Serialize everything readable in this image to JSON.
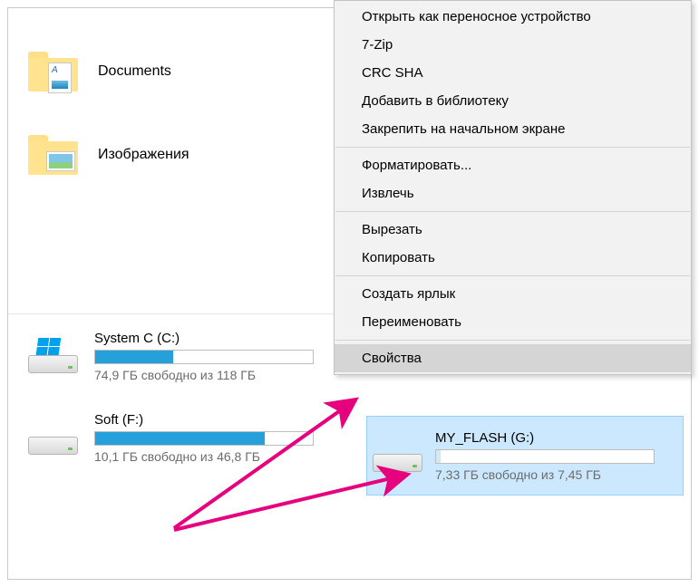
{
  "folders": {
    "docs": {
      "label": "Documents"
    },
    "images": {
      "label": "Изображения"
    }
  },
  "drives": {
    "system": {
      "label": "System C (C:)",
      "free": "74,9 ГБ свободно из 118 ГБ",
      "fill_pct": 36
    },
    "soft": {
      "label": "Soft (F:)",
      "free": "10,1 ГБ свободно из 46,8 ГБ",
      "fill_pct": 78
    },
    "flash": {
      "label": "MY_FLASH (G:)",
      "free": "7,33 ГБ свободно из 7,45 ГБ",
      "fill_pct": 2
    }
  },
  "ctx": {
    "open_portable": "Открыть как переносное устройство",
    "sevenzip": "7-Zip",
    "crcsha": "CRC SHA",
    "add_library": "Добавить в библиотеку",
    "pin_start": "Закрепить на начальном экране",
    "format": "Форматировать...",
    "eject": "Извлечь",
    "cut": "Вырезать",
    "copy": "Копировать",
    "shortcut": "Создать ярлык",
    "rename": "Переименовать",
    "properties": "Свойства"
  },
  "colors": {
    "accent": "#e6007e"
  }
}
